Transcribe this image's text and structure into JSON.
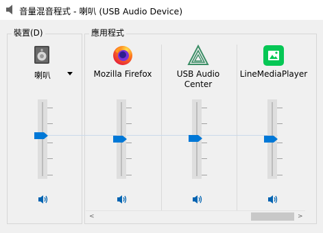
{
  "window": {
    "title": "音量混音程式 - 喇叭 (USB Audio Device)"
  },
  "device_group": {
    "label": "裝置(D)",
    "device": {
      "name": "喇叭",
      "icon": "speaker-device-icon",
      "volume_level": 0.55
    }
  },
  "apps_group": {
    "label": "應用程式",
    "apps": [
      {
        "name": "Mozilla Firefox",
        "icon": "firefox-icon",
        "volume_level": 0.5
      },
      {
        "name": "USB Audio\nCenter",
        "icon": "usb-audio-center-icon",
        "volume_level": 0.5
      },
      {
        "name": "LineMediaPlayer",
        "icon": "line-media-player-icon",
        "volume_level": 0.5
      }
    ]
  },
  "scrollbar": {
    "left_arrow": "<",
    "right_arrow": ">"
  },
  "colors": {
    "accent": "#0078d7",
    "group_border": "#d6d6d6",
    "background": "#f0f0f0"
  }
}
